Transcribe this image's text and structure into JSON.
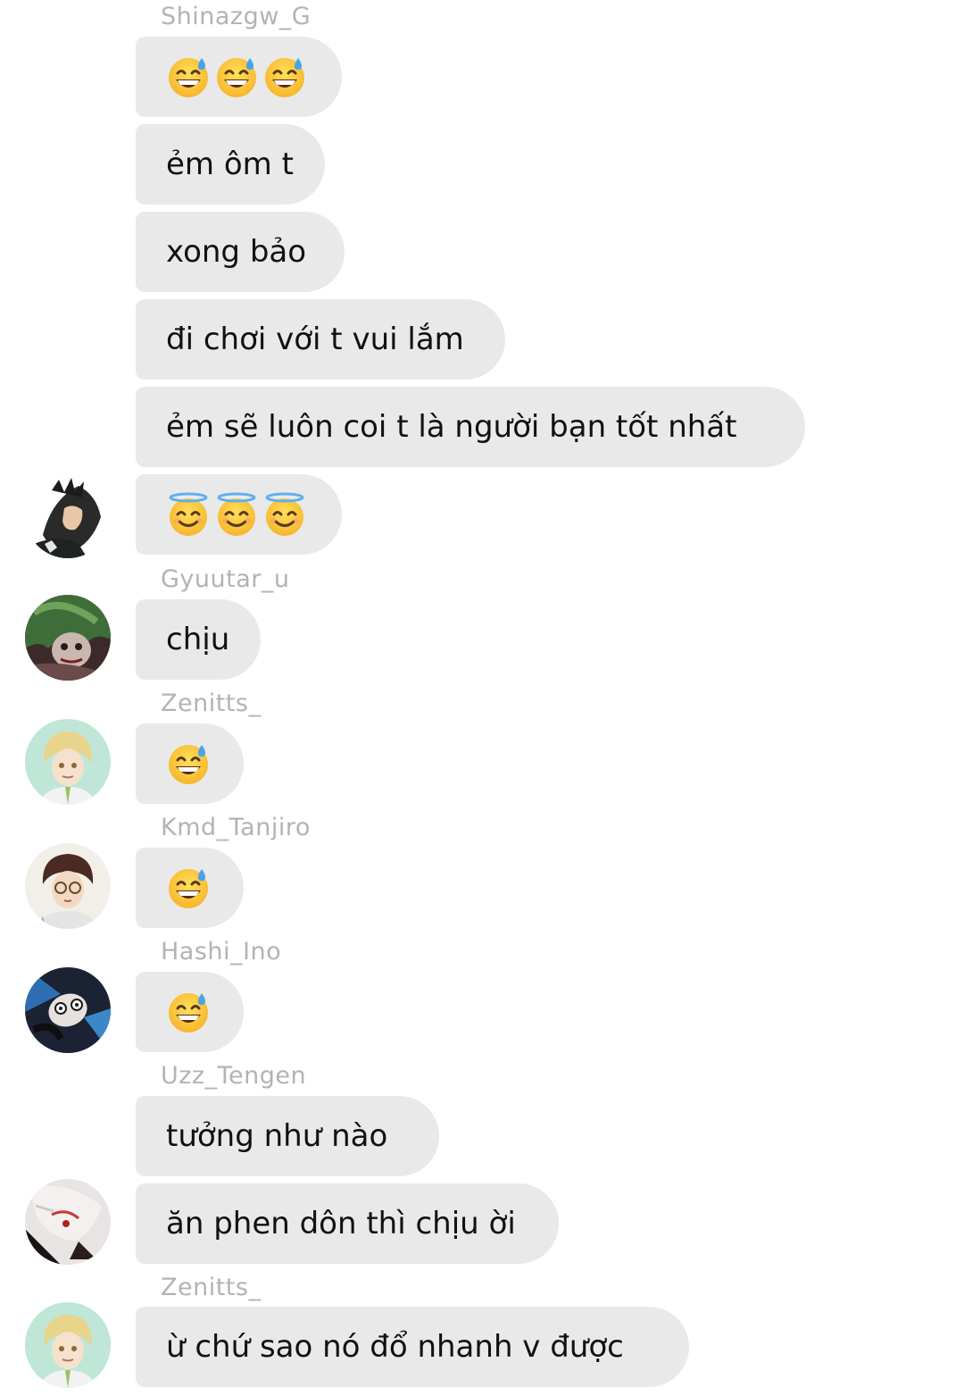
{
  "chat": {
    "groups": [
      {
        "sender": "Shinazgw_G",
        "messages": [
          {
            "type": "emoji",
            "icons": [
              "grinning-sweat-emoji",
              "grinning-sweat-emoji",
              "grinning-sweat-emoji"
            ]
          },
          {
            "type": "text",
            "text": "ẻm ôm t"
          },
          {
            "type": "text",
            "text": "xong bảo"
          },
          {
            "type": "text",
            "text": "đi chơi với t vui lắm"
          },
          {
            "type": "text",
            "text": "ẻm sẽ luôn coi t là người bạn tốt nhất"
          },
          {
            "type": "emoji",
            "icons": [
              "halo-smile-emoji",
              "halo-smile-emoji",
              "halo-smile-emoji"
            ]
          }
        ],
        "avatar": "dark-hair-character-avatar"
      },
      {
        "sender": "Gyuutar_u",
        "messages": [
          {
            "type": "text",
            "text": "chịu"
          }
        ],
        "avatar": "green-hair-character-avatar"
      },
      {
        "sender": "Zenitts_",
        "messages": [
          {
            "type": "emoji",
            "icons": [
              "grinning-sweat-emoji"
            ]
          }
        ],
        "avatar": "blonde-character-avatar"
      },
      {
        "sender": "Kmd_Tanjiro",
        "messages": [
          {
            "type": "emoji",
            "icons": [
              "grinning-sweat-emoji"
            ]
          }
        ],
        "avatar": "glasses-character-avatar"
      },
      {
        "sender": "Hashi_Ino",
        "messages": [
          {
            "type": "emoji",
            "icons": [
              "grinning-sweat-emoji"
            ]
          }
        ],
        "avatar": "blue-character-avatar"
      },
      {
        "sender": "Uzz_Tengen",
        "messages": [
          {
            "type": "text",
            "text": "tưởng như nào"
          },
          {
            "type": "text",
            "text": "ăn phen dôn thì chịu ời"
          }
        ],
        "avatar": "white-hair-character-avatar"
      },
      {
        "sender": "Zenitts_",
        "messages": [
          {
            "type": "text",
            "text": "ừ chứ sao nó đổ nhanh v được"
          }
        ],
        "avatar": "blonde-character-avatar"
      }
    ]
  },
  "colors": {
    "bubble": "#e9e9e9",
    "sender_text": "#b3b3b3",
    "message_text": "#111111",
    "background": "#ffffff"
  }
}
